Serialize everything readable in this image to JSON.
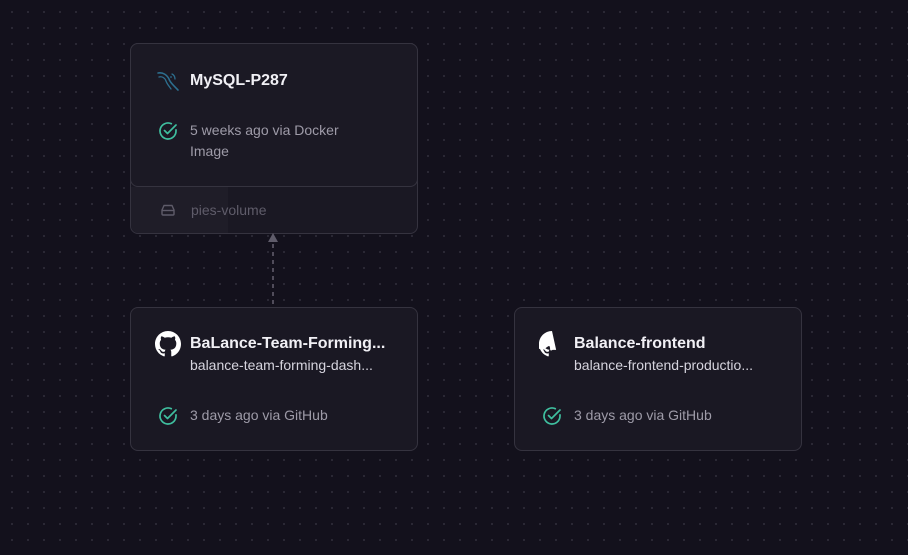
{
  "canvas": {
    "background": "#13111c",
    "accent_success": "#3fbf9f"
  },
  "services": [
    {
      "name": "MySQL-P287",
      "icon": "mysql-icon",
      "status_text": "5 weeks ago via Docker Image",
      "status_icon": "check-circle-icon",
      "volume": {
        "label": "pies-volume",
        "icon": "hard-drive-icon"
      }
    },
    {
      "name": "BaLance-Team-Forming...",
      "subtitle": "balance-team-forming-dash...",
      "icon": "github-icon",
      "status_text": "3 days ago via GitHub",
      "status_icon": "check-circle-icon"
    },
    {
      "name": "Balance-frontend",
      "subtitle": "balance-frontend-productio...",
      "icon": "github-icon",
      "status_text": "3 days ago via GitHub",
      "status_icon": "check-circle-icon"
    }
  ]
}
